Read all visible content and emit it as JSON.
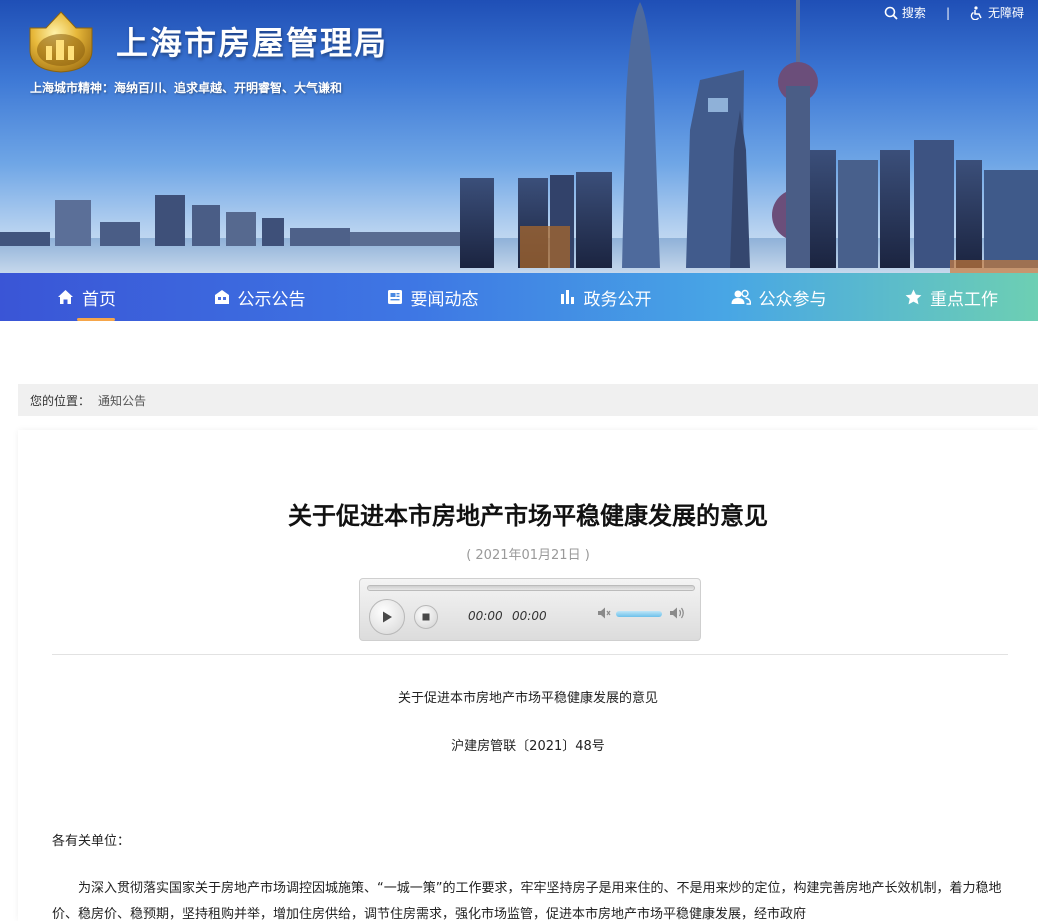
{
  "header": {
    "site_title": "上海市房屋管理局",
    "motto": "上海城市精神：海纳百川、追求卓越、开明睿智、大气谦和",
    "search_label": "搜索",
    "separator": "|",
    "accessibility_label": "无障碍"
  },
  "nav": {
    "items": [
      {
        "label": "首页",
        "icon": "home-icon",
        "active": true
      },
      {
        "label": "公示公告",
        "icon": "building-icon"
      },
      {
        "label": "要闻动态",
        "icon": "newspaper-icon"
      },
      {
        "label": "政务公开",
        "icon": "bar-chart-icon"
      },
      {
        "label": "公众参与",
        "icon": "users-icon"
      },
      {
        "label": "重点工作",
        "icon": "star-icon"
      }
    ]
  },
  "breadcrumb": {
    "prefix": "您的位置：",
    "current": "通知公告"
  },
  "article": {
    "title": "关于促进本市房地产市场平稳健康发展的意见",
    "date": "( 2021年01月21日 )",
    "player": {
      "current_time": "00:00",
      "duration": "00:00",
      "progress": 0,
      "volume": 0.8
    },
    "doc_heading": "关于促进本市房地产市场平稳健康发展的意见",
    "doc_number": "沪建房管联〔2021〕48号",
    "salutation": "各有关单位：",
    "body": "为深入贯彻落实国家关于房地产市场调控因城施策、“一城一策”的工作要求，牢牢坚持房子是用来住的、不是用来炒的定位，构建完善房地产长效机制，着力稳地价、稳房价、稳预期，坚持租购并举，增加住房供给，调节住房需求，强化市场监管，促进本市房地产市场平稳健康发展，经市政府"
  },
  "colors": {
    "nav_start": "#3a55d6",
    "nav_end": "#6dcfb3",
    "active_underline": "#f6a64a",
    "breadcrumb_bg": "#f0f0f0"
  }
}
